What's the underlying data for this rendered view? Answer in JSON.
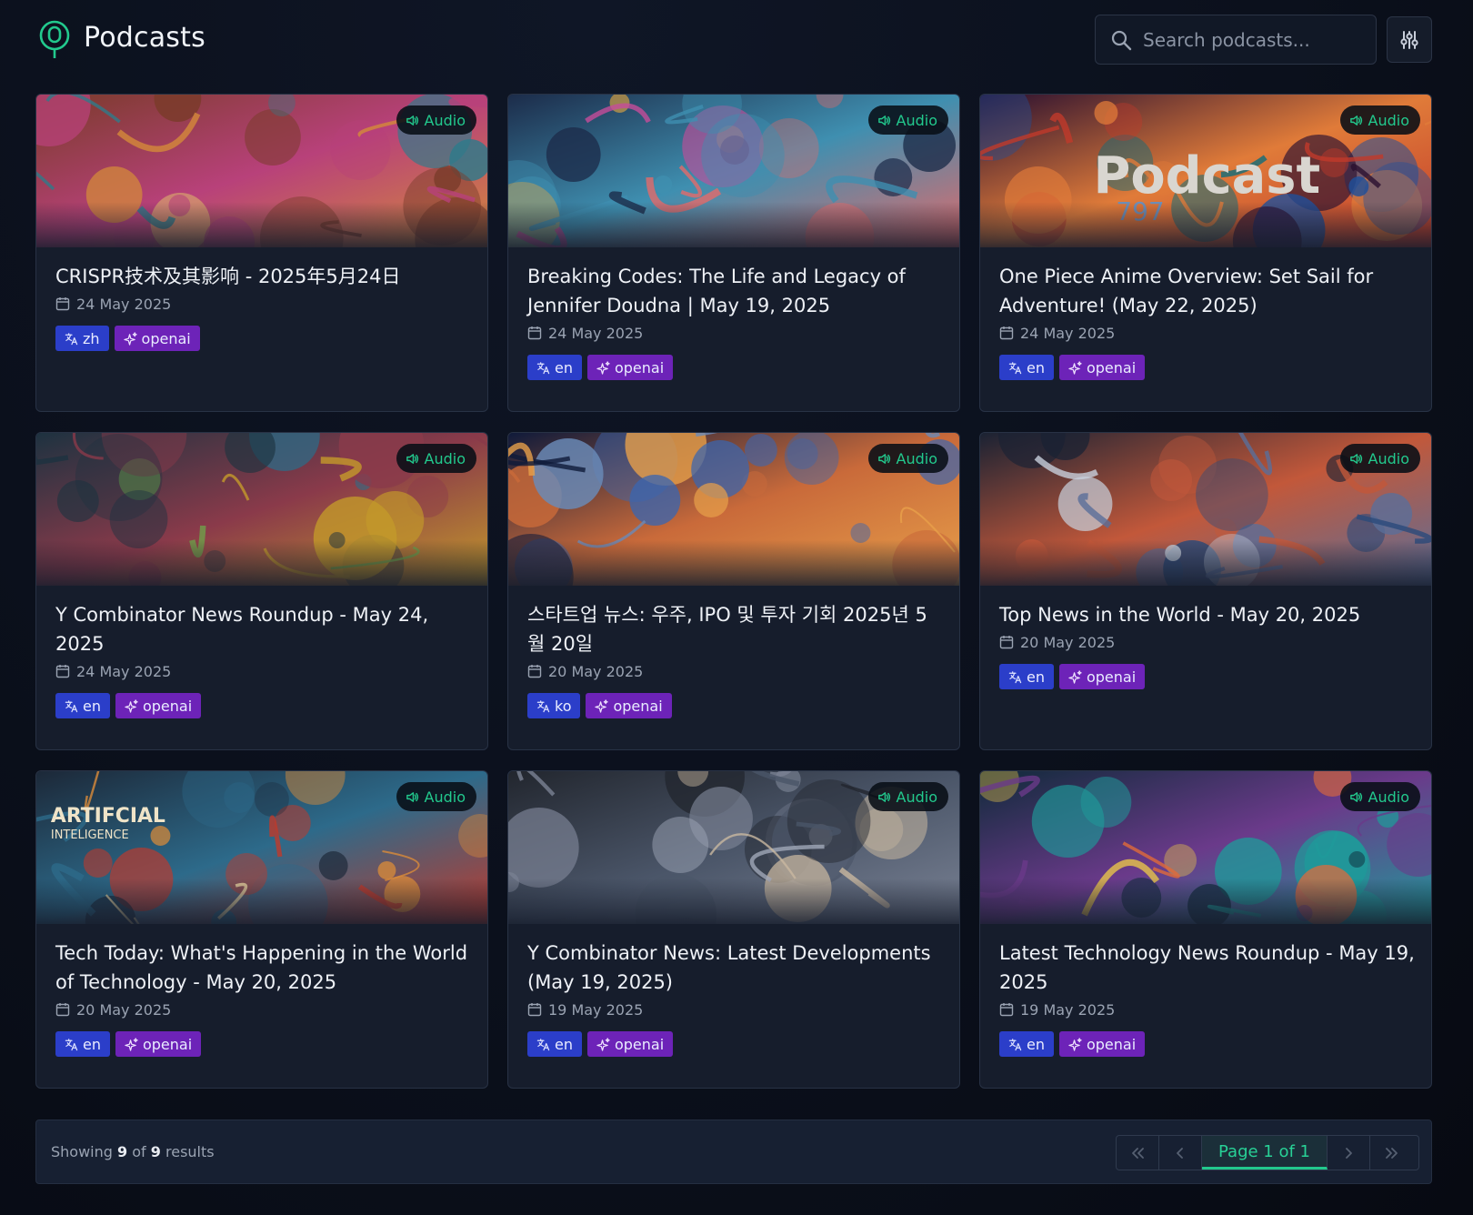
{
  "header": {
    "title": "Podcasts",
    "search_placeholder": "Search podcasts...",
    "search_value": ""
  },
  "colors": {
    "accent": "#22c98d",
    "lang_tag": "#2b3ec9",
    "model_tag": "#6d23b8",
    "card_bg": "#161d2c"
  },
  "icons": {
    "logo": "podcast-mic-icon",
    "search": "search-icon",
    "filter": "sliders-icon",
    "audio": "speaker-icon",
    "date": "calendar-icon",
    "language": "translate-icon",
    "model": "sparkles-icon"
  },
  "cards": [
    {
      "badge": "Audio",
      "title": "CRISPR技术及其影响 - 2025年5月24日",
      "date": "24 May 2025",
      "lang": "zh",
      "model": "openai"
    },
    {
      "badge": "Audio",
      "title": "Breaking Codes: The Life and Legacy of Jennifer Doudna | May 19, 2025",
      "date": "24 May 2025",
      "lang": "en",
      "model": "openai"
    },
    {
      "badge": "Audio",
      "title": "One Piece Anime Overview: Set Sail for Adventure! (May 22, 2025)",
      "date": "24 May 2025",
      "lang": "en",
      "model": "openai",
      "image_text": "Podcast",
      "image_subtext": "797"
    },
    {
      "badge": "Audio",
      "title": "Y Combinator News Roundup - May 24, 2025",
      "date": "24 May 2025",
      "lang": "en",
      "model": "openai"
    },
    {
      "badge": "Audio",
      "title": "스타트업 뉴스: 우주, IPO 및 투자 기회 2025년 5월 20일",
      "date": "20 May 2025",
      "lang": "ko",
      "model": "openai"
    },
    {
      "badge": "Audio",
      "title": "Top News in the World - May 20, 2025",
      "date": "20 May 2025",
      "lang": "en",
      "model": "openai"
    },
    {
      "badge": "Audio",
      "title": "Tech Today: What's Happening in the World of Technology - May 20, 2025",
      "date": "20 May 2025",
      "lang": "en",
      "model": "openai",
      "image_text": "ARTIFCIAL",
      "image_subtext": "INTELIGENCE"
    },
    {
      "badge": "Audio",
      "title": "Y Combinator News: Latest Developments (May 19, 2025)",
      "date": "19 May 2025",
      "lang": "en",
      "model": "openai"
    },
    {
      "badge": "Audio",
      "title": "Latest Technology News Roundup - May 19, 2025",
      "date": "19 May 2025",
      "lang": "en",
      "model": "openai"
    }
  ],
  "footer": {
    "showing_prefix": "Showing",
    "shown_count": "9",
    "of_label": "of",
    "total_count": "9",
    "results_label": "results",
    "page_label": "Page 1 of 1"
  }
}
